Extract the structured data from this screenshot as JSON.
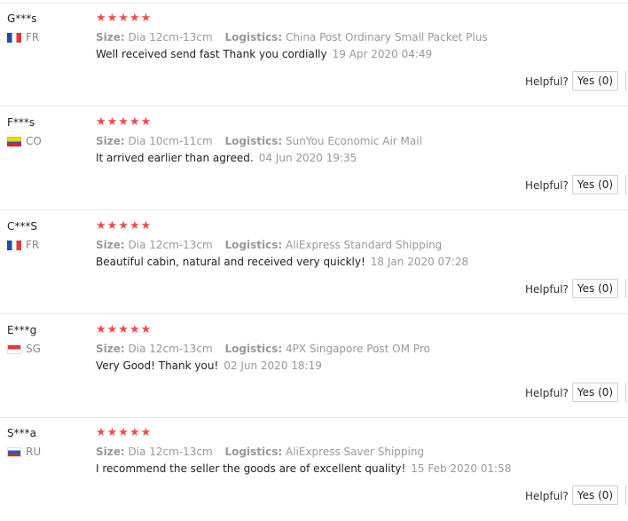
{
  "reviews": [
    {
      "user": "G***s",
      "country": "FR",
      "flag": "fr",
      "stars": "★★★★★",
      "size_label": "Size:",
      "size": "Dia 12cm-13cm",
      "logistics_label": "Logistics:",
      "logistics": "China Post Ordinary Small Packet Plus",
      "text": "Well received send fast Thank you cordially",
      "date": "19 Apr 2020 04:49",
      "helpful": "Helpful?",
      "yes": "Yes (0)"
    },
    {
      "user": "F***s",
      "country": "CO",
      "flag": "co",
      "stars": "★★★★★",
      "size_label": "Size:",
      "size": "Dia 10cm-11cm",
      "logistics_label": "Logistics:",
      "logistics": "SunYou Economic Air Mail",
      "text": "It arrived earlier than agreed.",
      "date": "04 Jun 2020 19:35",
      "helpful": "Helpful?",
      "yes": "Yes (0)"
    },
    {
      "user": "C***S",
      "country": "FR",
      "flag": "fr",
      "stars": "★★★★★",
      "size_label": "Size:",
      "size": "Dia 12cm-13cm",
      "logistics_label": "Logistics:",
      "logistics": "AliExpress Standard Shipping",
      "text": "Beautiful cabin, natural and received very quickly!",
      "date": "18 Jan 2020 07:28",
      "helpful": "Helpful?",
      "yes": "Yes (0)"
    },
    {
      "user": "E***g",
      "country": "SG",
      "flag": "sg",
      "stars": "★★★★★",
      "size_label": "Size:",
      "size": "Dia 12cm-13cm",
      "logistics_label": "Logistics:",
      "logistics": "4PX Singapore Post OM Pro",
      "text": "Very Good! Thank you!",
      "date": "02 Jun 2020 18:19",
      "helpful": "Helpful?",
      "yes": "Yes (0)"
    },
    {
      "user": "S***a",
      "country": "RU",
      "flag": "ru",
      "stars": "★★★★★",
      "size_label": "Size:",
      "size": "Dia 12cm-13cm",
      "logistics_label": "Logistics:",
      "logistics": "AliExpress Saver Shipping",
      "text": "I recommend the seller the goods are of excellent quality!",
      "date": "15 Feb 2020 01:58",
      "helpful": "Helpful?",
      "yes": "Yes (0)"
    }
  ],
  "colors": {
    "star": "#f24b4b",
    "muted": "#999999",
    "border": "#e6e6e6"
  }
}
